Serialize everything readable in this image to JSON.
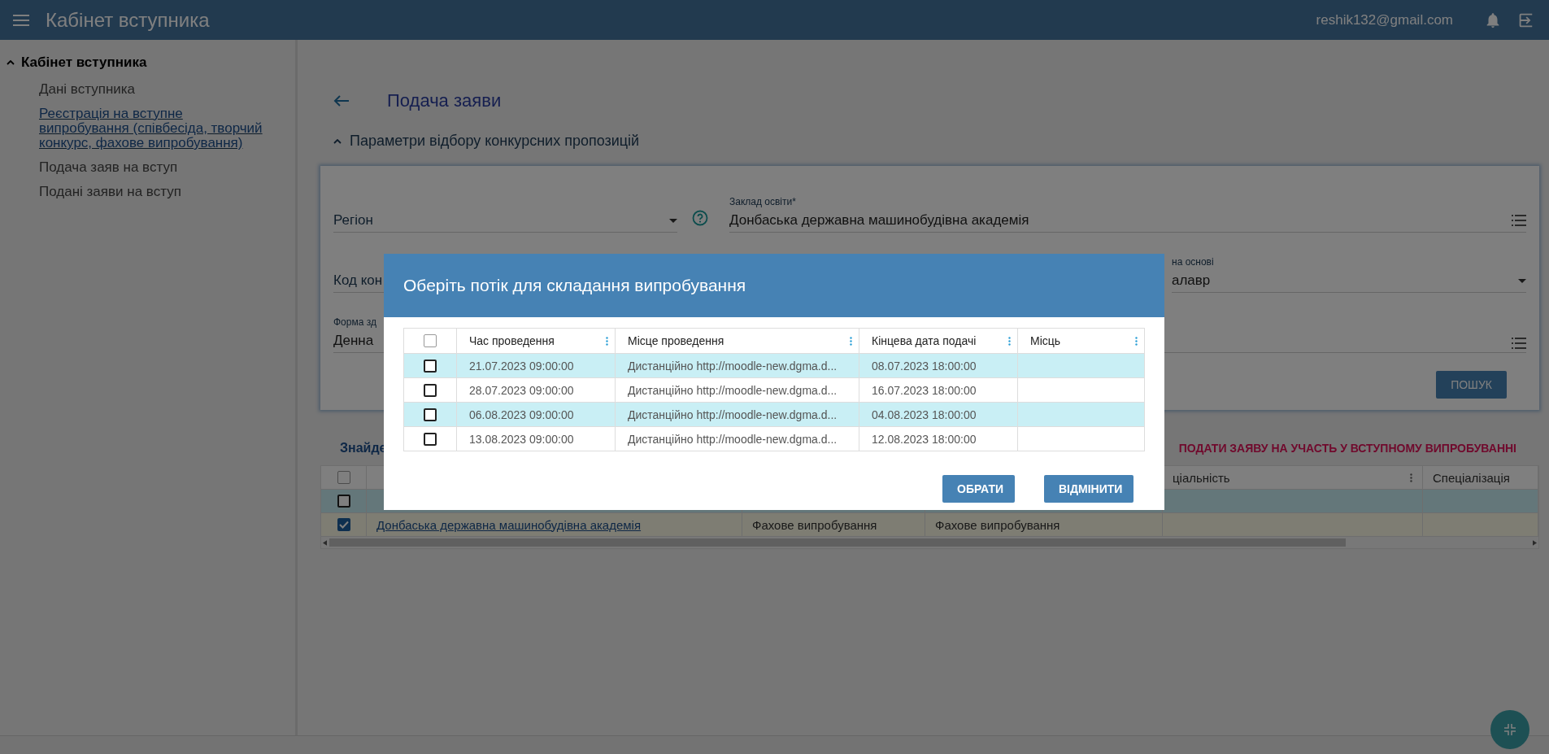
{
  "header": {
    "title": "Кабінет вступника",
    "user_email": "reshik132@gmail.com"
  },
  "sidebar": {
    "group": {
      "label": "Кабінет вступника",
      "expanded": true
    },
    "items": [
      {
        "label": "Дані вступника",
        "selected": false
      },
      {
        "label": "Реєстрація на вступне випробування (співбесіда, творчий конкурс, фахове випробування)",
        "selected": true
      },
      {
        "label": "Подача заяв на вступ",
        "selected": false
      },
      {
        "label": "Подані заяви на вступ",
        "selected": false
      }
    ]
  },
  "page": {
    "title": "Подача заяви",
    "section": {
      "label": "Параметри відбору конкурсних пропозицій",
      "expanded": true
    },
    "form": {
      "rows": [
        [
          {
            "kind": "select",
            "placeholder": "Регіон",
            "help": true
          },
          {
            "kind": "list",
            "label": "Заклад освіти*",
            "value": "Донбаська державна машинобудівна академія"
          }
        ],
        [
          {
            "kind": "text",
            "placeholder": "Код кон"
          },
          {
            "kind": "select",
            "label": "на основі",
            "value": "алавр"
          }
        ],
        [
          {
            "kind": "text",
            "label": "Форма зд",
            "value": "Денна"
          },
          {
            "kind": "list"
          }
        ]
      ]
    },
    "search_button": "ПОШУК"
  },
  "results": {
    "found_label": "Знайде",
    "apply_link": "ПОДАТИ ЗАЯВУ НА УЧАСТЬ У ВСТУПНОМУ ВИПРОБУВАННІ",
    "table": {
      "all_checked": false,
      "columns": [
        {
          "menu": false
        },
        {
          "menu": false
        },
        {
          "menu": false
        },
        {
          "label": "ціальність",
          "menu": true
        },
        {
          "label": "Спеціалізація",
          "menu": false
        }
      ],
      "rows": [
        {
          "checked": false,
          "highlighted": true,
          "cells": []
        },
        {
          "checked": true,
          "highlighted": false,
          "cells": [
            "Донбаська державна машинобудівна академія",
            "Фахове випробування",
            "Фахове випробування"
          ]
        }
      ]
    }
  },
  "dialog": {
    "title": "Оберіть потік для складання випробування",
    "all_checked": false,
    "columns": [
      {
        "label": "Час проведення",
        "menu": true
      },
      {
        "label": "Місце проведення",
        "menu": true
      },
      {
        "label": "Кінцева дата подачі",
        "menu": true
      },
      {
        "label": "Місць",
        "menu": true
      }
    ],
    "rows": [
      {
        "checked": false,
        "highlighted": true,
        "time": "21.07.2023 09:00:00",
        "place": "Дистанційно http://moodle-new.dgma.d...",
        "deadline": "08.07.2023 18:00:00"
      },
      {
        "checked": false,
        "highlighted": false,
        "time": "28.07.2023 09:00:00",
        "place": "Дистанційно http://moodle-new.dgma.d...",
        "deadline": "16.07.2023 18:00:00"
      },
      {
        "checked": false,
        "highlighted": true,
        "time": "06.08.2023 09:00:00",
        "place": "Дистанційно http://moodle-new.dgma.d...",
        "deadline": "04.08.2023 18:00:00"
      },
      {
        "checked": false,
        "highlighted": false,
        "time": "13.08.2023 09:00:00",
        "place": "Дистанційно http://moodle-new.dgma.d...",
        "deadline": "12.08.2023 18:00:00"
      }
    ],
    "buttons": [
      "ОБРАТИ",
      "ВІДМІНИТИ"
    ]
  }
}
